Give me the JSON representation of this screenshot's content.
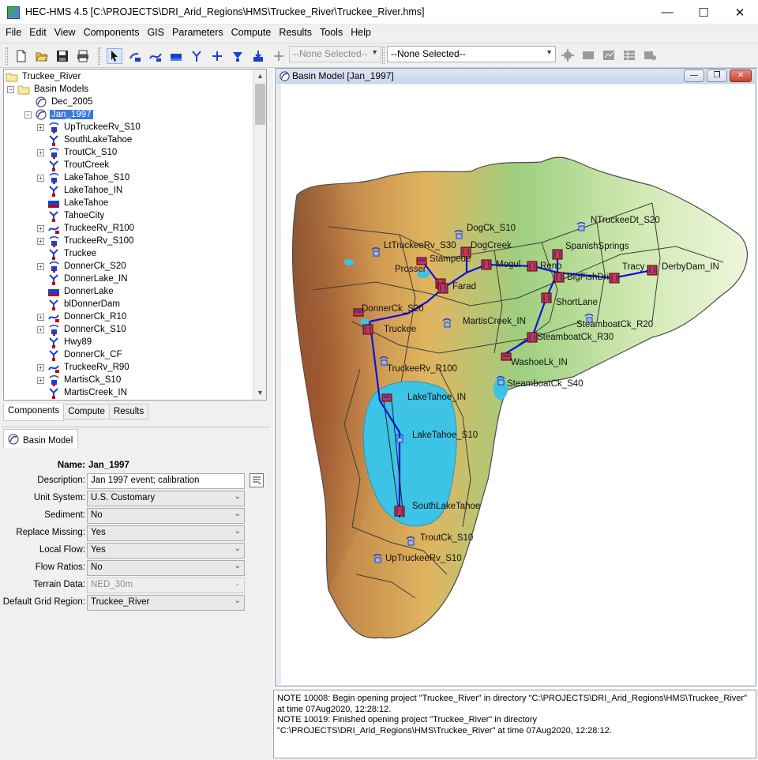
{
  "window": {
    "title": "HEC-HMS 4.5 [C:\\PROJECTS\\DRI_Arid_Regions\\HMS\\Truckee_River\\Truckee_River.hms]"
  },
  "menu": [
    "File",
    "Edit",
    "View",
    "Components",
    "GIS",
    "Parameters",
    "Compute",
    "Results",
    "Tools",
    "Help"
  ],
  "toolbar": {
    "select_1": "--None Selected--",
    "select_2": "--None Selected--"
  },
  "tree": {
    "root": "Truckee_River",
    "basin_models": "Basin Models",
    "items": [
      "Dec_2005",
      "Jan_1997",
      "UpTruckeeRv_S10",
      "SouthLakeTahoe",
      "TroutCk_S10",
      "TroutCreek",
      "LakeTahoe_S10",
      "LakeTahoe_IN",
      "LakeTahoe",
      "TahoeCity",
      "TruckeeRv_R100",
      "TruckeeRv_S100",
      "Truckee",
      "DonnerCk_S20",
      "DonnerLake_IN",
      "DonnerLake",
      "blDonnerDam",
      "DonnerCk_R10",
      "DonnerCk_S10",
      "Hwy89",
      "DonnerCk_CF",
      "TruckeeRv_R90",
      "MartisCk_S10",
      "MartisCreek_IN"
    ]
  },
  "bottom_tabs": [
    "Components",
    "Compute",
    "Results"
  ],
  "properties": {
    "tab": "Basin Model",
    "name_label": "Name:",
    "name_value": "Jan_1997",
    "fields": [
      {
        "label": "Description:",
        "value": "Jan 1997 event; calibration"
      },
      {
        "label": "Unit System:",
        "value": "U.S. Customary"
      },
      {
        "label": "Sediment:",
        "value": "No"
      },
      {
        "label": "Replace Missing:",
        "value": "Yes"
      },
      {
        "label": "Local Flow:",
        "value": "Yes"
      },
      {
        "label": "Flow Ratios:",
        "value": "No"
      },
      {
        "label": "Terrain Data:",
        "value": "NED_30m"
      },
      {
        "label": "Default Grid Region:",
        "value": "Truckee_River"
      }
    ]
  },
  "basin_window": {
    "title": "Basin Model [Jan_1997]"
  },
  "map_labels": [
    "DogCk_S10",
    "NTruckeeDt_S20",
    "LtTruckeeRv_S30",
    "Stampede",
    "DogCreek",
    "Mogul",
    "Reno",
    "SpanishSprings",
    "BigFishDrive",
    "Tracy",
    "DerbyDam_IN",
    "Prosser",
    "Farad",
    "ShortLane",
    "DonnerCk_S20",
    "Truckee",
    "MartisCreek_IN",
    "SteamboatCk_R20",
    "SteamboatCk_R30",
    "WashoeLk_IN",
    "SteamboatCk_S40",
    "TruckeeRv_R100",
    "LakeTahoe_IN",
    "LakeTahoe_S10",
    "SouthLakeTahoe",
    "TroutCk_S10",
    "UpTruckeeRv_S10"
  ],
  "messages": [
    "NOTE 10008:  Begin opening project \"Truckee_River\" in directory \"C:\\PROJECTS\\DRI_Arid_Regions\\HMS\\Truckee_River\" at time 07Aug2020, 12:28:12.",
    "NOTE 10019:  Finished opening project \"Truckee_River\" in directory \"C:\\PROJECTS\\DRI_Arid_Regions\\HMS\\Truckee_River\" at time 07Aug2020, 12:28:12."
  ],
  "colors": {
    "selection": "#3a78d8",
    "lake": "#3cc3e6",
    "reach": "#1010e0",
    "element_red": "#e03030"
  }
}
